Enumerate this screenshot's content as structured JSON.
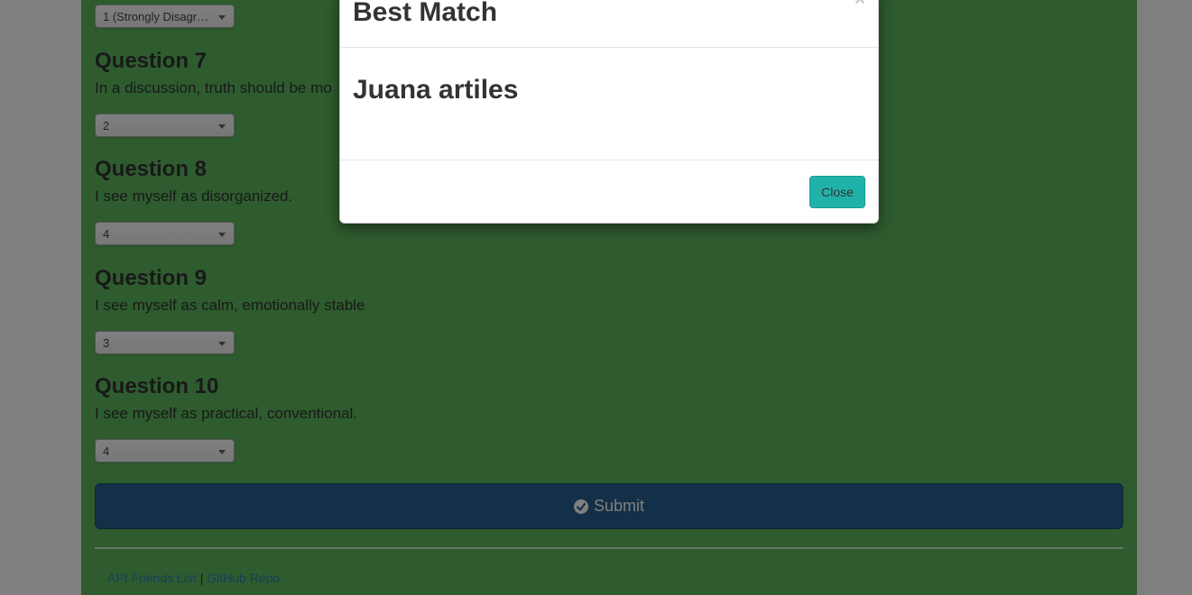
{
  "questions": [
    {
      "title": "",
      "text": "",
      "selected": "1 (Strongly Disagree)"
    },
    {
      "title": "Question 7",
      "text": "In a discussion, truth should be mo",
      "selected": "2"
    },
    {
      "title": "Question 8",
      "text": "I see myself as disorganized.",
      "selected": "4"
    },
    {
      "title": "Question 9",
      "text": "I see myself as calm, emotionally stable",
      "selected": "3"
    },
    {
      "title": "Question 10",
      "text": "I see myself as practical, conventional.",
      "selected": "4"
    }
  ],
  "submit": {
    "label": "Submit",
    "icon": "check-circle-icon"
  },
  "footer": {
    "link1": "API Friends List",
    "separator": "|",
    "link2": "GitHub Repo"
  },
  "modal": {
    "title": "Best Match",
    "close_x": "×",
    "match_name": "Juana artiles",
    "close_label": "Close"
  },
  "colors": {
    "page_bg": "#5cb85c",
    "submit_bg": "#286090",
    "close_btn": "#20b2aa",
    "link": "#337ab7"
  }
}
